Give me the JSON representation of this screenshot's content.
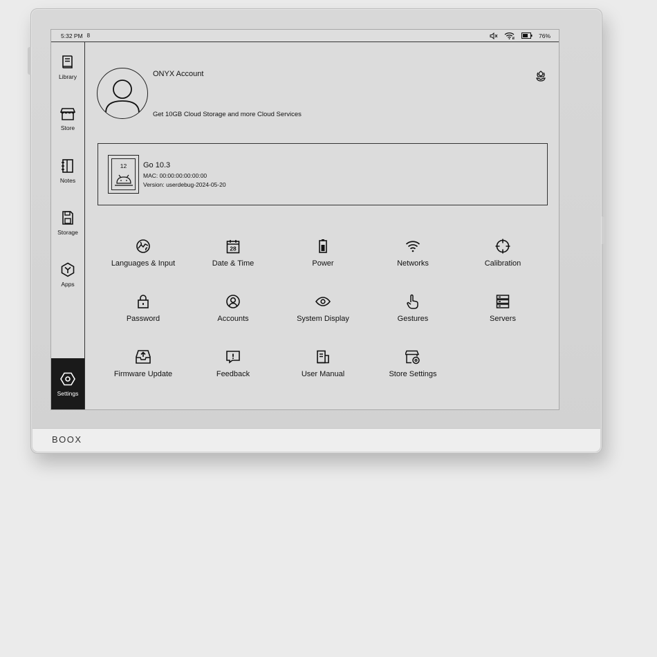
{
  "device": {
    "brand": "BOOX"
  },
  "status": {
    "time": "5:32 PM",
    "notif": "8",
    "battery": "76%"
  },
  "sidebar": {
    "items": [
      {
        "label": "Library",
        "icon": "library-icon"
      },
      {
        "label": "Store",
        "icon": "store-icon"
      },
      {
        "label": "Notes",
        "icon": "notes-icon"
      },
      {
        "label": "Storage",
        "icon": "storage-icon"
      },
      {
        "label": "Apps",
        "icon": "apps-icon"
      },
      {
        "label": "Settings",
        "icon": "settings-icon",
        "active": true
      }
    ]
  },
  "account": {
    "title": "ONYX Account",
    "subtitle": "Get 10GB Cloud Storage and more Cloud Services"
  },
  "device_info": {
    "thumb_number": "12",
    "name": "Go 10.3",
    "mac": "MAC: 00:00:00:00:00:00",
    "version": "Version: userdebug-2024-05-20"
  },
  "settings": [
    {
      "label": "Languages & Input",
      "icon": "globe-icon"
    },
    {
      "label": "Date & Time",
      "icon": "calendar-icon",
      "icon_text": "28"
    },
    {
      "label": "Power",
      "icon": "battery-icon"
    },
    {
      "label": "Networks",
      "icon": "wifi-icon"
    },
    {
      "label": "Calibration",
      "icon": "crosshair-icon"
    },
    {
      "label": "Password",
      "icon": "lock-icon"
    },
    {
      "label": "Accounts",
      "icon": "user-circle-icon"
    },
    {
      "label": "System Display",
      "icon": "eye-icon"
    },
    {
      "label": "Gestures",
      "icon": "hand-pointer-icon"
    },
    {
      "label": "Servers",
      "icon": "server-icon"
    },
    {
      "label": "Firmware Update",
      "icon": "firmware-update-icon"
    },
    {
      "label": "Feedback",
      "icon": "feedback-icon"
    },
    {
      "label": "User Manual",
      "icon": "manual-icon"
    },
    {
      "label": "Store Settings",
      "icon": "store-settings-icon"
    }
  ]
}
